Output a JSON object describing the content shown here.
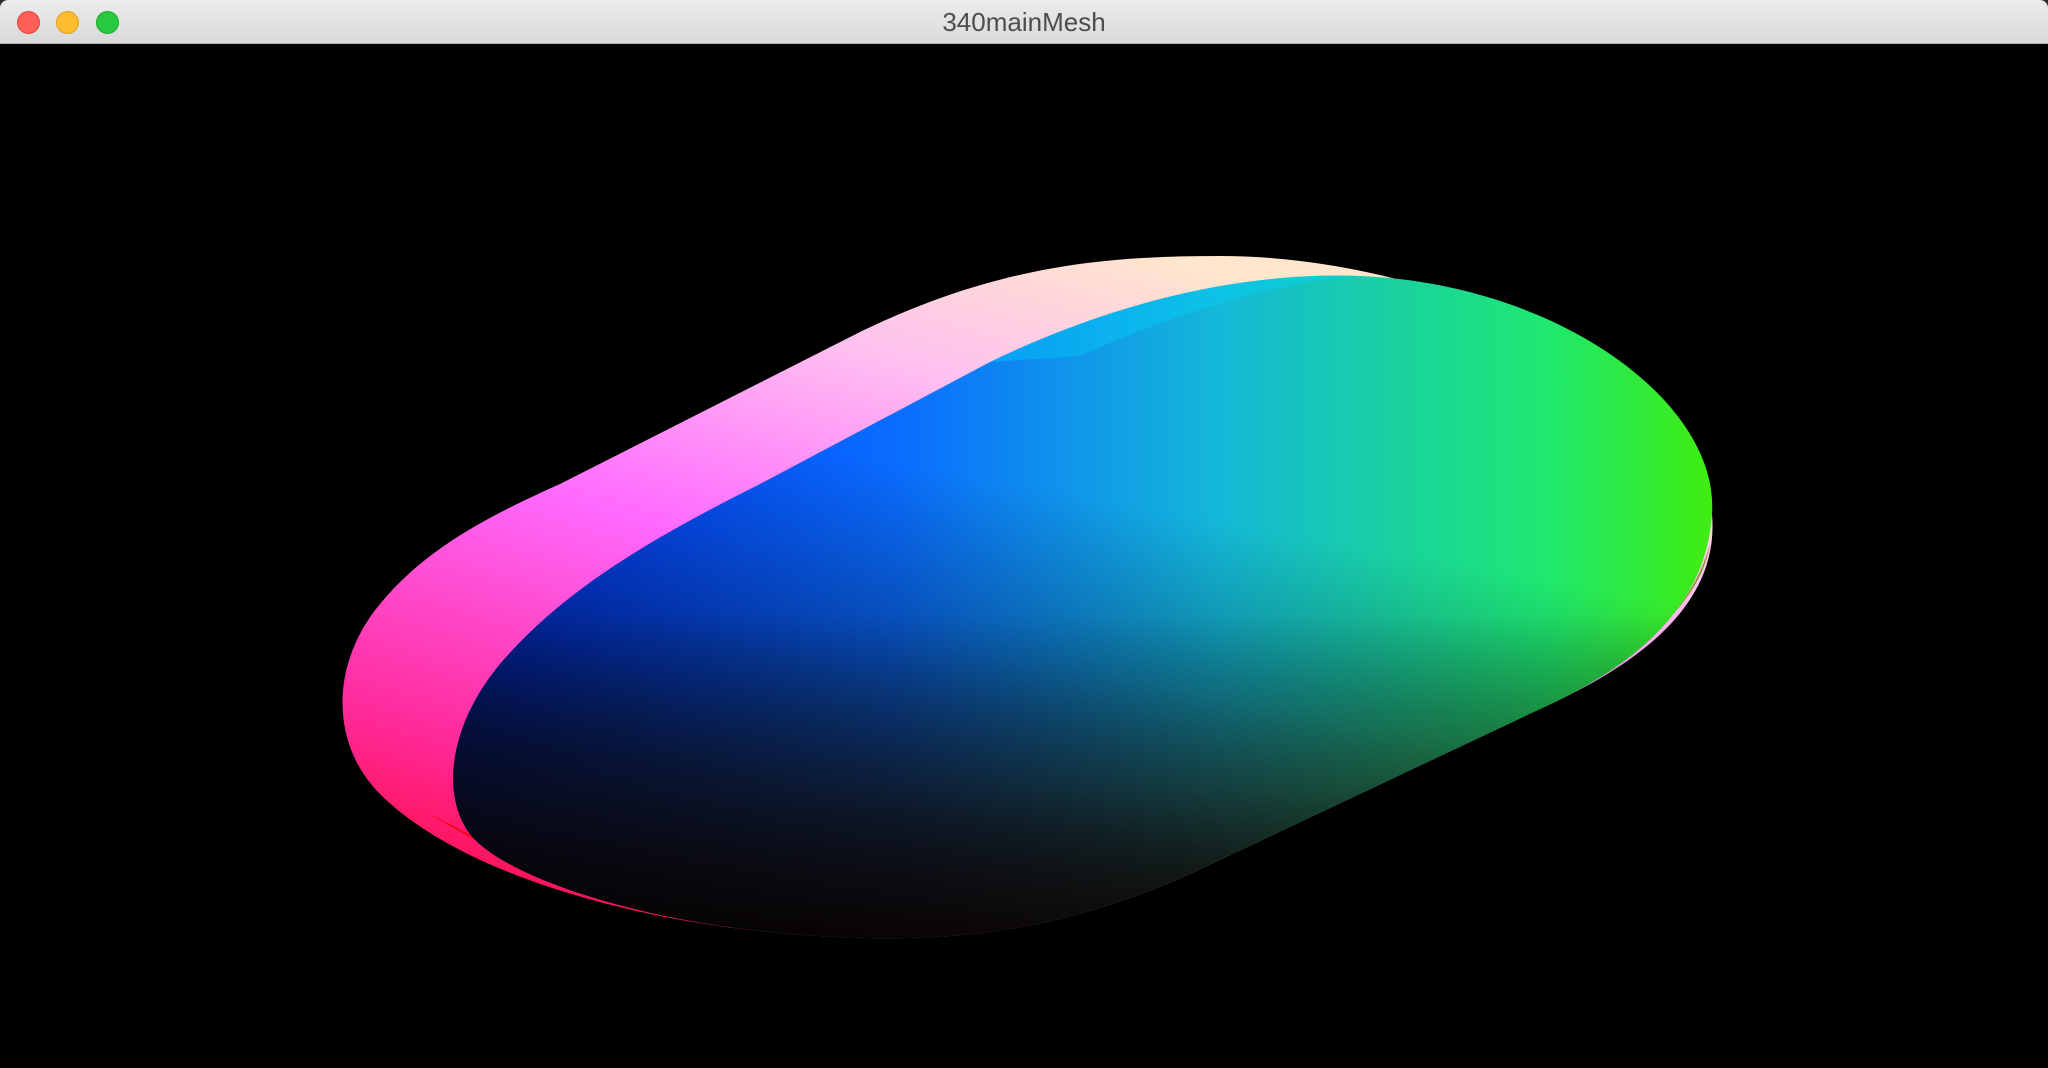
{
  "window": {
    "title": "340mainMesh",
    "controls": {
      "close": "close-icon",
      "minimize": "minimize-icon",
      "zoom": "zoom-icon"
    }
  },
  "viewport": {
    "background": "#000000",
    "mesh_colors": {
      "red": "#ff0033",
      "magenta": "#ff33ff",
      "blue": "#0040ff",
      "cyan": "#00c8ff",
      "green": "#44ee00",
      "dark": "#000000"
    }
  }
}
